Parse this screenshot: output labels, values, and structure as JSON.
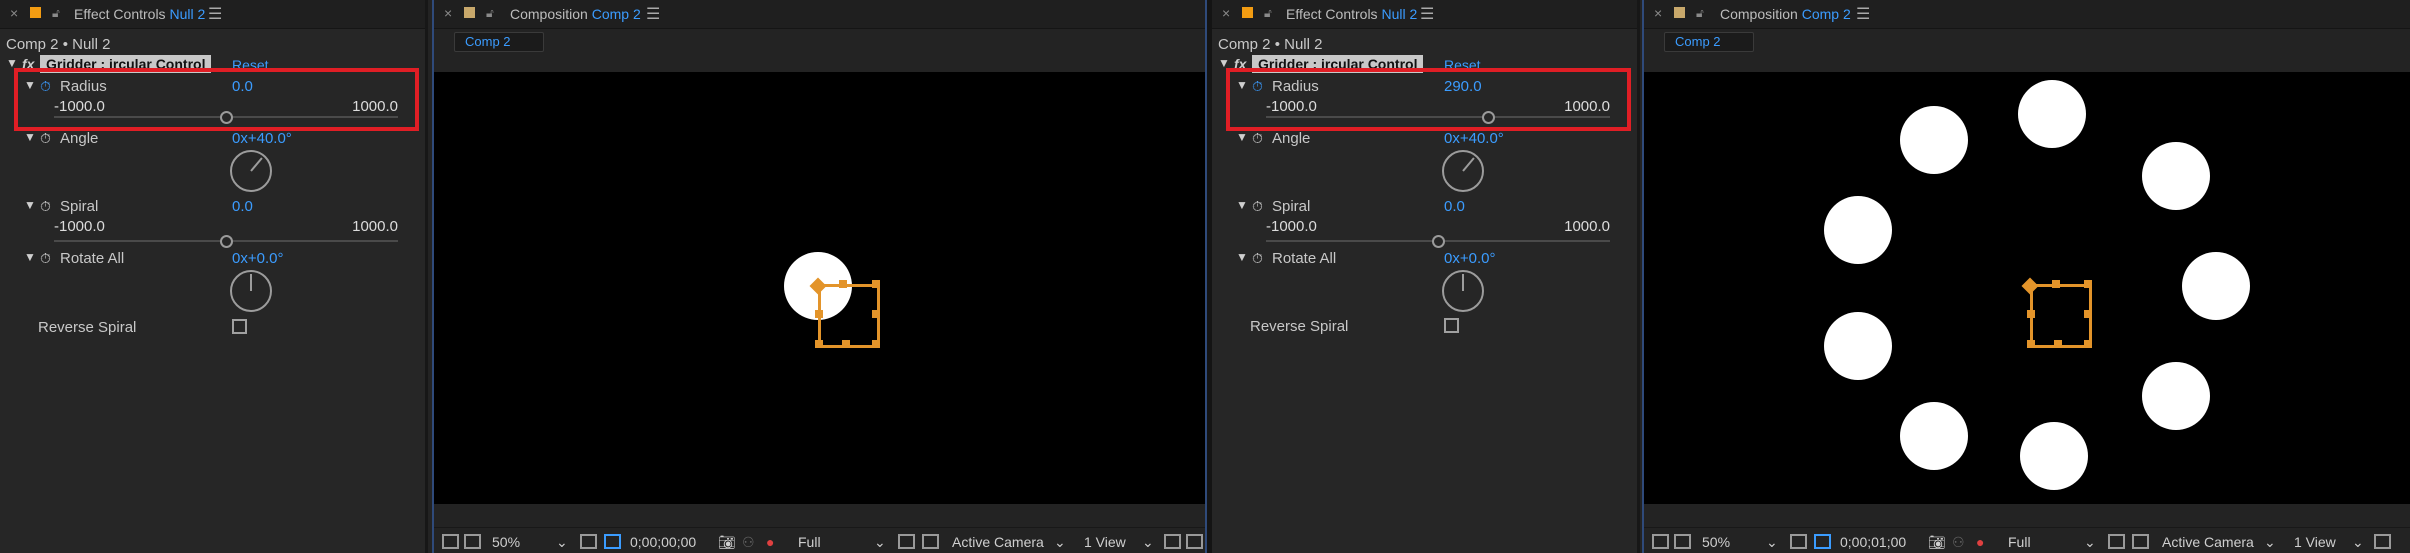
{
  "left": {
    "effect_controls": {
      "tab_title": "Effect Controls",
      "tab_layer": "Null 2",
      "breadcrumb": "Comp 2 • Null 2",
      "effect_name": "Gridder : ircular Control",
      "reset_label": "Reset",
      "radius": {
        "label": "Radius",
        "value": "0.0",
        "min": "-1000.0",
        "max": "1000.0",
        "fraction": 0.5
      },
      "angle": {
        "label": "Angle",
        "value": "0x+40.0°",
        "degrees": 40
      },
      "spiral": {
        "label": "Spiral",
        "value": "0.0",
        "min": "-1000.0",
        "max": "1000.0",
        "fraction": 0.5
      },
      "rotate_all": {
        "label": "Rotate All",
        "value": "0x+0.0°",
        "degrees": 0
      },
      "reverse_spiral": {
        "label": "Reverse Spiral",
        "checked": false
      }
    },
    "composition": {
      "tab_title": "Composition",
      "tab_comp": "Comp 2",
      "view_tab": "Comp 2",
      "footer": {
        "zoom": "50%",
        "timecode": "0;00;00;00",
        "resolution": "Full",
        "camera": "Active Camera",
        "views": "1 View"
      }
    }
  },
  "right": {
    "effect_controls": {
      "tab_title": "Effect Controls",
      "tab_layer": "Null 2",
      "breadcrumb": "Comp 2 • Null 2",
      "effect_name": "Gridder : ircular Control",
      "reset_label": "Reset",
      "radius": {
        "label": "Radius",
        "value": "290.0",
        "min": "-1000.0",
        "max": "1000.0",
        "fraction": 0.645
      },
      "angle": {
        "label": "Angle",
        "value": "0x+40.0°",
        "degrees": 40
      },
      "spiral": {
        "label": "Spiral",
        "value": "0.0",
        "min": "-1000.0",
        "max": "1000.0",
        "fraction": 0.5
      },
      "rotate_all": {
        "label": "Rotate All",
        "value": "0x+0.0°",
        "degrees": 0
      },
      "reverse_spiral": {
        "label": "Reverse Spiral",
        "checked": false
      }
    },
    "composition": {
      "tab_title": "Composition",
      "tab_comp": "Comp 2",
      "view_tab": "Comp 2",
      "footer": {
        "zoom": "50%",
        "timecode": "0;00;01;00",
        "resolution": "Full",
        "camera": "Active Camera",
        "views": "1 View"
      }
    }
  },
  "colors": {
    "accent": "#3b9cff",
    "highlight": "#e01e25",
    "null_handle": "#e3942a",
    "label_swatch_ec": "#f39c12",
    "label_swatch_comp": "#c8a86b"
  },
  "icons": [
    "close-icon",
    "label-swatch",
    "lock-icon",
    "menu-icon",
    "stopwatch-icon",
    "camera-icon",
    "checkbox"
  ]
}
